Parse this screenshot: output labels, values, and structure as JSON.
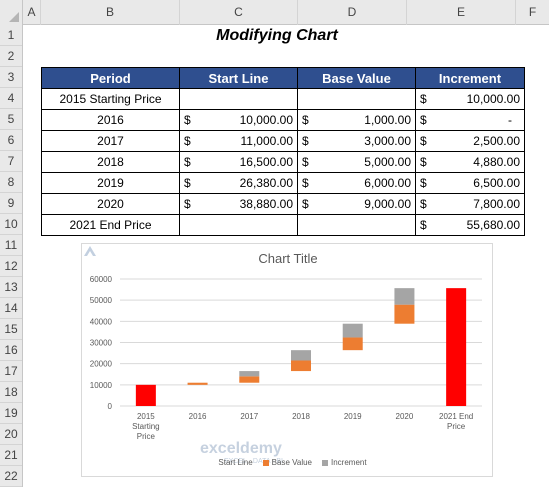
{
  "sheet": {
    "columns": [
      "A",
      "B",
      "C",
      "D",
      "E",
      "F"
    ],
    "rows": [
      "1",
      "2",
      "3",
      "4",
      "5",
      "6",
      "7",
      "8",
      "9",
      "10",
      "11",
      "12",
      "13",
      "14",
      "15",
      "16",
      "17",
      "18",
      "19",
      "20",
      "21",
      "22"
    ]
  },
  "title": "Modifying Chart",
  "table": {
    "headers": [
      "Period",
      "Start Line",
      "Base Value",
      "Increment"
    ],
    "currency": "$",
    "rows": [
      {
        "period": "2015 Starting Price",
        "start": "",
        "base": "",
        "inc": "10,000.00"
      },
      {
        "period": "2016",
        "start": "10,000.00",
        "base": "1,000.00",
        "inc": "-"
      },
      {
        "period": "2017",
        "start": "11,000.00",
        "base": "3,000.00",
        "inc": "2,500.00"
      },
      {
        "period": "2018",
        "start": "16,500.00",
        "base": "5,000.00",
        "inc": "4,880.00"
      },
      {
        "period": "2019",
        "start": "26,380.00",
        "base": "6,000.00",
        "inc": "6,500.00"
      },
      {
        "period": "2020",
        "start": "38,880.00",
        "base": "9,000.00",
        "inc": "7,800.00"
      },
      {
        "period": "2021 End Price",
        "start": "",
        "base": "",
        "inc": "55,680.00"
      }
    ]
  },
  "watermark": {
    "name": "exceldemy",
    "sub": "EXCEL · DATA · BI"
  },
  "chart_data": {
    "type": "bar",
    "title": "Chart Title",
    "categories": [
      [
        "2015",
        "Starting",
        "Price"
      ],
      [
        "2016"
      ],
      [
        "2017"
      ],
      [
        "2018"
      ],
      [
        "2019"
      ],
      [
        "2020"
      ],
      [
        "2021 End",
        "Price"
      ]
    ],
    "ylim": [
      0,
      60000
    ],
    "yticks": [
      "0",
      "10000",
      "20000",
      "30000",
      "40000",
      "50000",
      "60000"
    ],
    "colors": {
      "start": "#ff0000",
      "base": "#ed7d31",
      "increment": "#a5a5a5",
      "grid": "#d9d9d9"
    },
    "series": [
      {
        "name": "Start Line",
        "values": [
          10000,
          10000,
          11000,
          16500,
          26380,
          38880,
          55680
        ]
      },
      {
        "name": "Base Value",
        "values": [
          0,
          1000,
          3000,
          5000,
          6000,
          9000,
          0
        ]
      },
      {
        "name": "Increment",
        "values": [
          0,
          0,
          2500,
          4880,
          6500,
          7800,
          0
        ]
      }
    ],
    "legend": [
      "Start Line",
      "Base Value",
      "Increment"
    ],
    "legend_position": "bottom"
  }
}
